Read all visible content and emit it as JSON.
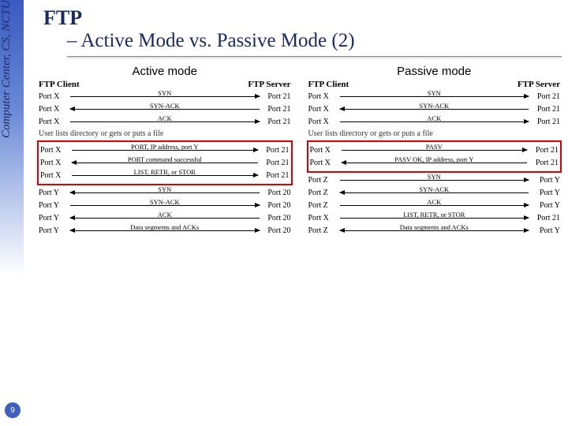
{
  "sidebar": {
    "text": "Computer Center, CS, NCTU"
  },
  "page_number": "9",
  "title": {
    "line1": "FTP",
    "line2": "– Active Mode vs. Passive Mode (2)"
  },
  "diagrams": {
    "active": {
      "header": "Active mode",
      "client_label": "FTP Client",
      "server_label": "FTP Server",
      "note": "User lists directory or gets or puts a file",
      "rows_top": [
        {
          "pl": "Port X",
          "label": "SYN",
          "dir": "right",
          "pr": "Port 21"
        },
        {
          "pl": "Port X",
          "label": "SYN-ACK",
          "dir": "left",
          "pr": "Port 21"
        },
        {
          "pl": "Port X",
          "label": "ACK",
          "dir": "right",
          "pr": "Port 21"
        }
      ],
      "rows_cmd": [
        {
          "pl": "Port X",
          "label": "PORT, IP address, port Y",
          "dir": "right",
          "pr": "Port 21"
        },
        {
          "pl": "Port X",
          "label": "PORT command successful",
          "dir": "left",
          "pr": "Port 21"
        },
        {
          "pl": "Port X",
          "label": "LIST, RETR, or STOR",
          "dir": "right",
          "pr": "Port 21"
        }
      ],
      "rows_data": [
        {
          "pl": "Port Y",
          "label": "SYN",
          "dir": "left",
          "pr": "Port 20"
        },
        {
          "pl": "Port Y",
          "label": "SYN-ACK",
          "dir": "right",
          "pr": "Port 20"
        },
        {
          "pl": "Port Y",
          "label": "ACK",
          "dir": "left",
          "pr": "Port 20"
        },
        {
          "pl": "Port Y",
          "label": "Data segments and ACKs",
          "dir": "both",
          "pr": "Port 20"
        }
      ]
    },
    "passive": {
      "header": "Passive mode",
      "client_label": "FTP Client",
      "server_label": "FTP Server",
      "note": "User lists directory or gets or puts a file",
      "rows_top": [
        {
          "pl": "Port X",
          "label": "SYN",
          "dir": "right",
          "pr": "Port 21"
        },
        {
          "pl": "Port X",
          "label": "SYN-ACK",
          "dir": "left",
          "pr": "Port 21"
        },
        {
          "pl": "Port X",
          "label": "ACK",
          "dir": "right",
          "pr": "Port 21"
        }
      ],
      "rows_cmd": [
        {
          "pl": "Port X",
          "label": "PASV",
          "dir": "right",
          "pr": "Port 21"
        },
        {
          "pl": "Port X",
          "label": "PASV OK, IP address, port Y",
          "dir": "left",
          "pr": "Port 21"
        }
      ],
      "rows_data": [
        {
          "pl": "Port Z",
          "label": "SYN",
          "dir": "right",
          "pr": "Port Y"
        },
        {
          "pl": "Port Z",
          "label": "SYN-ACK",
          "dir": "left",
          "pr": "Port Y"
        },
        {
          "pl": "Port Z",
          "label": "ACK",
          "dir": "right",
          "pr": "Port Y"
        },
        {
          "pl": "Port X",
          "label": "LIST, RETR, or STOR",
          "dir": "right",
          "pr": "Port 21"
        },
        {
          "pl": "Port Z",
          "label": "Data segments and ACKs",
          "dir": "both",
          "pr": "Port Y"
        }
      ]
    }
  }
}
